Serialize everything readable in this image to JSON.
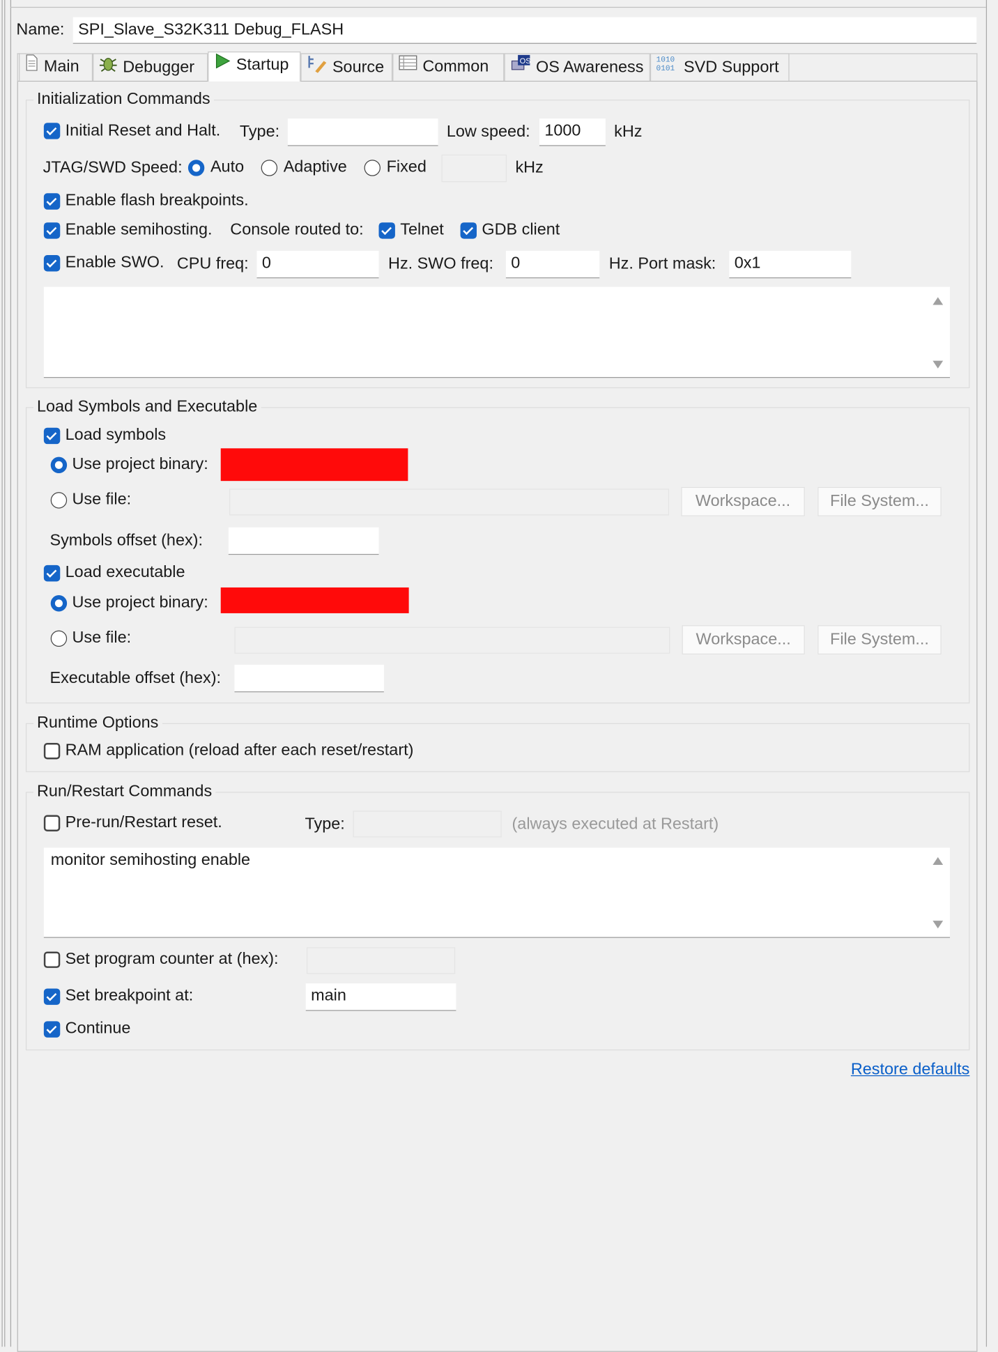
{
  "name": {
    "label": "Name:",
    "value": "SPI_Slave_S32K311 Debug_FLASH"
  },
  "tabs": [
    {
      "label": "Main",
      "icon": "document-icon"
    },
    {
      "label": "Debugger",
      "icon": "bug-icon"
    },
    {
      "label": "Startup",
      "icon": "play-icon",
      "selected": true
    },
    {
      "label": "Source",
      "icon": "source-icon"
    },
    {
      "label": "Common",
      "icon": "table-icon"
    },
    {
      "label": "OS Awareness",
      "icon": "os-icon"
    },
    {
      "label": "SVD Support",
      "icon": "binary-icon"
    }
  ],
  "init": {
    "title": "Initialization Commands",
    "initial_reset": {
      "label": "Initial Reset and Halt.",
      "checked": true
    },
    "type_label": "Type:",
    "type_value": "",
    "low_speed_label": "Low speed:",
    "low_speed_value": "1000",
    "khz": "kHz",
    "jtag_label": "JTAG/SWD Speed:",
    "speed_options": [
      "Auto",
      "Adaptive",
      "Fixed"
    ],
    "speed_selected": "Auto",
    "fixed_value": "",
    "khz2": "kHz",
    "flash_bp": {
      "label": "Enable flash breakpoints.",
      "checked": true
    },
    "semihosting": {
      "label": "Enable semihosting.",
      "checked": true
    },
    "console_label": "Console routed to:",
    "telnet": {
      "label": "Telnet",
      "checked": true
    },
    "gdb_client": {
      "label": "GDB client",
      "checked": true
    },
    "swo": {
      "label": "Enable SWO.",
      "checked": true
    },
    "cpu_freq_label": "CPU freq:",
    "cpu_freq": "0",
    "swo_freq_label": "Hz.  SWO freq:",
    "swo_freq": "0",
    "port_mask_label": "Hz.  Port mask:",
    "port_mask": "0x1",
    "commands": ""
  },
  "load": {
    "title": "Load Symbols and Executable",
    "load_symbols": {
      "label": "Load symbols",
      "checked": true
    },
    "use_project_binary": "Use project binary:",
    "use_file": "Use file:",
    "workspace": "Workspace...",
    "file_system": "File System...",
    "symbols_offset_label": "Symbols offset (hex):",
    "symbols_offset": "",
    "load_executable": {
      "label": "Load executable",
      "checked": true
    },
    "executable_offset_label": "Executable offset (hex):",
    "executable_offset": ""
  },
  "runtime": {
    "title": "Runtime Options",
    "ram_app": {
      "label": "RAM application (reload after each reset/restart)",
      "checked": false
    }
  },
  "run": {
    "title": "Run/Restart Commands",
    "pre_run": {
      "label": "Pre-run/Restart reset.",
      "checked": false
    },
    "type_label": "Type:",
    "type_value": "",
    "note": "(always executed at Restart)",
    "commands": "monitor semihosting enable",
    "set_pc": {
      "label": "Set program counter at (hex):",
      "checked": false,
      "value": ""
    },
    "set_bp": {
      "label": "Set breakpoint at:",
      "checked": true,
      "value": "main"
    },
    "continue": {
      "label": "Continue",
      "checked": true
    }
  },
  "restore_defaults": "Restore defaults",
  "colors": {
    "accent": "#1565c8",
    "redacted": "#ff0a0a",
    "link": "#0a5fc9"
  }
}
